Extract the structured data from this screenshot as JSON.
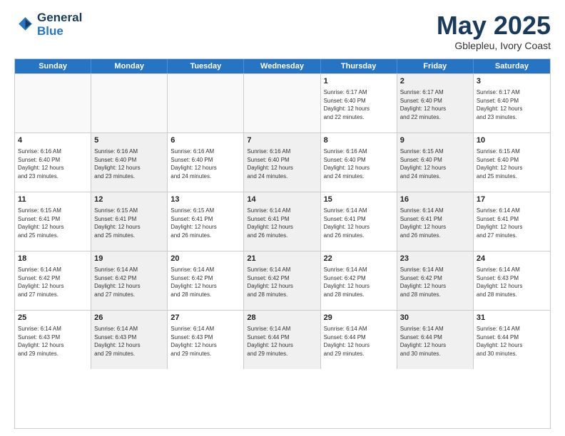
{
  "header": {
    "logo_line1": "General",
    "logo_line2": "Blue",
    "title": "May 2025",
    "subtitle": "Gblepleu, Ivory Coast"
  },
  "calendar": {
    "days_of_week": [
      "Sunday",
      "Monday",
      "Tuesday",
      "Wednesday",
      "Thursday",
      "Friday",
      "Saturday"
    ],
    "weeks": [
      [
        {
          "day": "",
          "info": "",
          "empty": true
        },
        {
          "day": "",
          "info": "",
          "empty": true
        },
        {
          "day": "",
          "info": "",
          "empty": true
        },
        {
          "day": "",
          "info": "",
          "empty": true
        },
        {
          "day": "1",
          "info": "Sunrise: 6:17 AM\nSunset: 6:40 PM\nDaylight: 12 hours\nand 22 minutes.",
          "empty": false
        },
        {
          "day": "2",
          "info": "Sunrise: 6:17 AM\nSunset: 6:40 PM\nDaylight: 12 hours\nand 22 minutes.",
          "empty": false,
          "shaded": true
        },
        {
          "day": "3",
          "info": "Sunrise: 6:17 AM\nSunset: 6:40 PM\nDaylight: 12 hours\nand 23 minutes.",
          "empty": false
        }
      ],
      [
        {
          "day": "4",
          "info": "Sunrise: 6:16 AM\nSunset: 6:40 PM\nDaylight: 12 hours\nand 23 minutes.",
          "empty": false
        },
        {
          "day": "5",
          "info": "Sunrise: 6:16 AM\nSunset: 6:40 PM\nDaylight: 12 hours\nand 23 minutes.",
          "empty": false,
          "shaded": true
        },
        {
          "day": "6",
          "info": "Sunrise: 6:16 AM\nSunset: 6:40 PM\nDaylight: 12 hours\nand 24 minutes.",
          "empty": false
        },
        {
          "day": "7",
          "info": "Sunrise: 6:16 AM\nSunset: 6:40 PM\nDaylight: 12 hours\nand 24 minutes.",
          "empty": false,
          "shaded": true
        },
        {
          "day": "8",
          "info": "Sunrise: 6:16 AM\nSunset: 6:40 PM\nDaylight: 12 hours\nand 24 minutes.",
          "empty": false
        },
        {
          "day": "9",
          "info": "Sunrise: 6:15 AM\nSunset: 6:40 PM\nDaylight: 12 hours\nand 24 minutes.",
          "empty": false,
          "shaded": true
        },
        {
          "day": "10",
          "info": "Sunrise: 6:15 AM\nSunset: 6:40 PM\nDaylight: 12 hours\nand 25 minutes.",
          "empty": false
        }
      ],
      [
        {
          "day": "11",
          "info": "Sunrise: 6:15 AM\nSunset: 6:41 PM\nDaylight: 12 hours\nand 25 minutes.",
          "empty": false
        },
        {
          "day": "12",
          "info": "Sunrise: 6:15 AM\nSunset: 6:41 PM\nDaylight: 12 hours\nand 25 minutes.",
          "empty": false,
          "shaded": true
        },
        {
          "day": "13",
          "info": "Sunrise: 6:15 AM\nSunset: 6:41 PM\nDaylight: 12 hours\nand 26 minutes.",
          "empty": false
        },
        {
          "day": "14",
          "info": "Sunrise: 6:14 AM\nSunset: 6:41 PM\nDaylight: 12 hours\nand 26 minutes.",
          "empty": false,
          "shaded": true
        },
        {
          "day": "15",
          "info": "Sunrise: 6:14 AM\nSunset: 6:41 PM\nDaylight: 12 hours\nand 26 minutes.",
          "empty": false
        },
        {
          "day": "16",
          "info": "Sunrise: 6:14 AM\nSunset: 6:41 PM\nDaylight: 12 hours\nand 26 minutes.",
          "empty": false,
          "shaded": true
        },
        {
          "day": "17",
          "info": "Sunrise: 6:14 AM\nSunset: 6:41 PM\nDaylight: 12 hours\nand 27 minutes.",
          "empty": false
        }
      ],
      [
        {
          "day": "18",
          "info": "Sunrise: 6:14 AM\nSunset: 6:42 PM\nDaylight: 12 hours\nand 27 minutes.",
          "empty": false
        },
        {
          "day": "19",
          "info": "Sunrise: 6:14 AM\nSunset: 6:42 PM\nDaylight: 12 hours\nand 27 minutes.",
          "empty": false,
          "shaded": true
        },
        {
          "day": "20",
          "info": "Sunrise: 6:14 AM\nSunset: 6:42 PM\nDaylight: 12 hours\nand 28 minutes.",
          "empty": false
        },
        {
          "day": "21",
          "info": "Sunrise: 6:14 AM\nSunset: 6:42 PM\nDaylight: 12 hours\nand 28 minutes.",
          "empty": false,
          "shaded": true
        },
        {
          "day": "22",
          "info": "Sunrise: 6:14 AM\nSunset: 6:42 PM\nDaylight: 12 hours\nand 28 minutes.",
          "empty": false
        },
        {
          "day": "23",
          "info": "Sunrise: 6:14 AM\nSunset: 6:42 PM\nDaylight: 12 hours\nand 28 minutes.",
          "empty": false,
          "shaded": true
        },
        {
          "day": "24",
          "info": "Sunrise: 6:14 AM\nSunset: 6:43 PM\nDaylight: 12 hours\nand 28 minutes.",
          "empty": false
        }
      ],
      [
        {
          "day": "25",
          "info": "Sunrise: 6:14 AM\nSunset: 6:43 PM\nDaylight: 12 hours\nand 29 minutes.",
          "empty": false
        },
        {
          "day": "26",
          "info": "Sunrise: 6:14 AM\nSunset: 6:43 PM\nDaylight: 12 hours\nand 29 minutes.",
          "empty": false,
          "shaded": true
        },
        {
          "day": "27",
          "info": "Sunrise: 6:14 AM\nSunset: 6:43 PM\nDaylight: 12 hours\nand 29 minutes.",
          "empty": false
        },
        {
          "day": "28",
          "info": "Sunrise: 6:14 AM\nSunset: 6:44 PM\nDaylight: 12 hours\nand 29 minutes.",
          "empty": false,
          "shaded": true
        },
        {
          "day": "29",
          "info": "Sunrise: 6:14 AM\nSunset: 6:44 PM\nDaylight: 12 hours\nand 29 minutes.",
          "empty": false
        },
        {
          "day": "30",
          "info": "Sunrise: 6:14 AM\nSunset: 6:44 PM\nDaylight: 12 hours\nand 30 minutes.",
          "empty": false,
          "shaded": true
        },
        {
          "day": "31",
          "info": "Sunrise: 6:14 AM\nSunset: 6:44 PM\nDaylight: 12 hours\nand 30 minutes.",
          "empty": false
        }
      ]
    ]
  }
}
